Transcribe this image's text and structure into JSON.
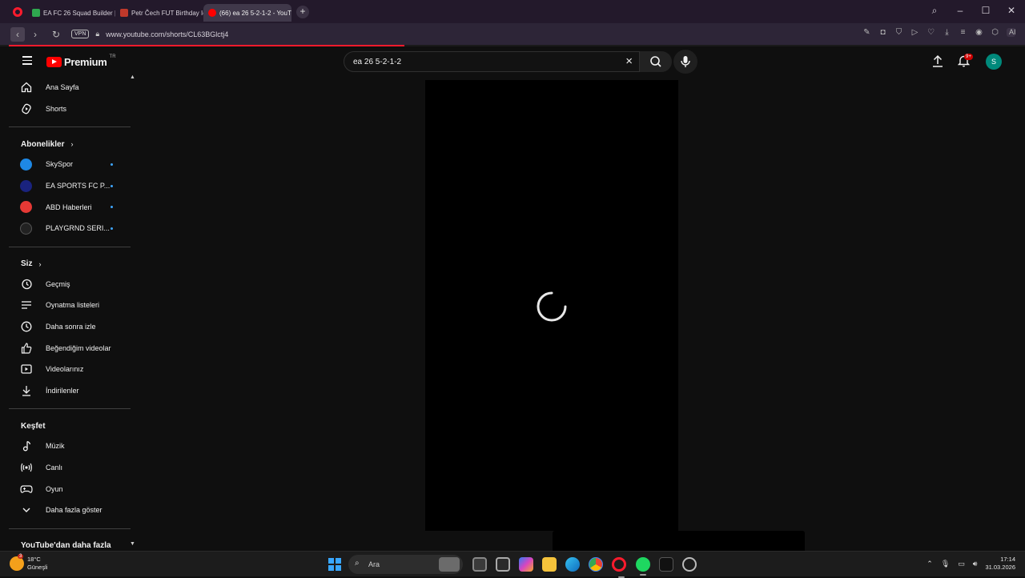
{
  "browser": {
    "tabs": [
      {
        "label": "EA FC 26 Squad Builder | F",
        "fav_color": "#2fa84f"
      },
      {
        "label": "Petr Čech FUT Birthday Ic",
        "fav_color": "#c0392b"
      },
      {
        "label": "(66) ea 26 5-2-1-2 - YouTu",
        "fav_color": "#ff0000",
        "active": true
      }
    ],
    "vpn_label": "VPN",
    "url": "www.youtube.com/shorts/CL63BGlctj4",
    "ai_label": "AI"
  },
  "youtube": {
    "logo_text": "Premium",
    "region": "TR",
    "search_value": "ea 26 5-2-1-2",
    "notification_badge": "9+",
    "avatar_letter": "S"
  },
  "sidebar": {
    "main": [
      {
        "label": "Ana Sayfa",
        "icon": "home-icon"
      },
      {
        "label": "Shorts",
        "icon": "shorts-icon"
      }
    ],
    "subscriptions_heading": "Abonelikler",
    "subscriptions": [
      {
        "label": "SkySpor",
        "color": "#1e88e5"
      },
      {
        "label": "EA SPORTS FC P...",
        "color": "#1a237e"
      },
      {
        "label": "ABD Haberleri",
        "color": "#e53935"
      },
      {
        "label": "PLAYGRND SERI...",
        "color": "#222222"
      }
    ],
    "you_heading": "Siz",
    "you": [
      {
        "label": "Geçmiş",
        "icon": "history-icon"
      },
      {
        "label": "Oynatma listeleri",
        "icon": "playlists-icon"
      },
      {
        "label": "Daha sonra izle",
        "icon": "watch-later-icon"
      },
      {
        "label": "Beğendiğim videolar",
        "icon": "liked-videos-icon"
      },
      {
        "label": "Videolarınız",
        "icon": "your-videos-icon"
      },
      {
        "label": "İndirilenler",
        "icon": "downloads-icon"
      }
    ],
    "explore_heading": "Keşfet",
    "explore": [
      {
        "label": "Müzik",
        "icon": "music-icon"
      },
      {
        "label": "Canlı",
        "icon": "live-icon"
      },
      {
        "label": "Oyun",
        "icon": "gaming-icon"
      },
      {
        "label": "Daha fazla göster",
        "icon": "chevron-down-icon"
      }
    ],
    "more_heading": "YouTube'dan daha fazla"
  },
  "taskbar": {
    "weather_temp": "18°C",
    "weather_desc": "Güneşli",
    "weather_badge": "3",
    "search_label": "Ara",
    "time": "17:14",
    "date": "31.03.2026"
  }
}
